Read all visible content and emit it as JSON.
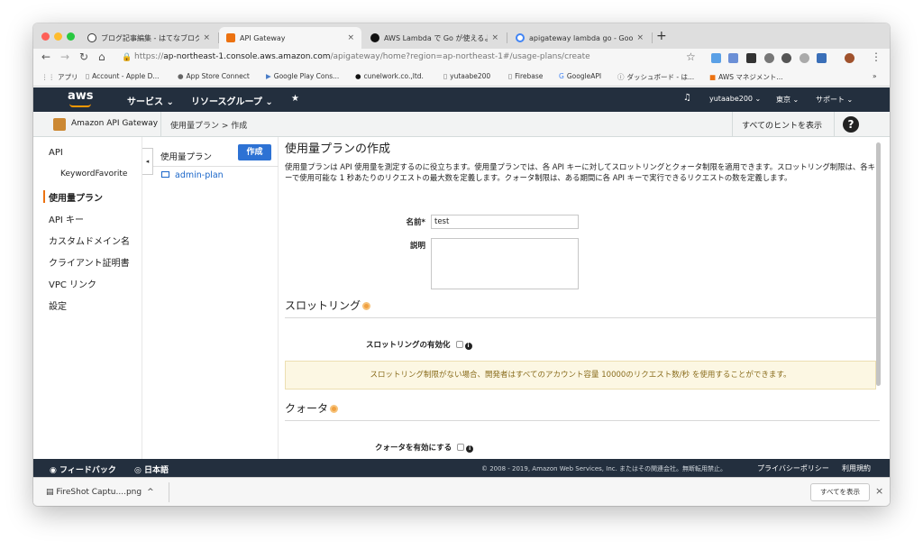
{
  "browser": {
    "tabs": [
      {
        "label": "ブログ記事編集 - はてなブログ",
        "close": "×",
        "icon_color": "#333333"
      },
      {
        "label": "API Gateway",
        "close": "×",
        "icon_color": "#ec7211"
      },
      {
        "label": "AWS Lambda で Go が使えるよ",
        "close": "×",
        "icon_color": "#111111"
      },
      {
        "label": "apigateway lambda go - Googl",
        "close": "×",
        "icon_color": "#4285f4"
      }
    ],
    "new_tab": "+",
    "url_prefix": "https://",
    "url_host": "ap-northeast-1.console.aws.amazon.com",
    "url_path": "/apigateway/home?region=ap-northeast-1#/usage-plans/create",
    "bookmarks": [
      {
        "icon": "apps-icon",
        "label": "アプリ"
      },
      {
        "icon": "page-icon",
        "label": "Account - Apple D..."
      },
      {
        "icon": "apple-icon",
        "label": "App Store Connect"
      },
      {
        "icon": "flag-icon",
        "label": "Google Play Cons..."
      },
      {
        "icon": "github-icon",
        "label": "cunelwork.co.,ltd."
      },
      {
        "icon": "page-icon",
        "label": "yutaabe200"
      },
      {
        "icon": "page-icon",
        "label": "Firebase"
      },
      {
        "icon": "google-icon",
        "label": "GoogleAPI"
      },
      {
        "icon": "info-icon",
        "label": "ダッシュボード - は..."
      },
      {
        "icon": "cube-icon",
        "label": "AWS マネジメント..."
      }
    ],
    "bookmarks_more": "»"
  },
  "aws": {
    "logo": "aws",
    "services": "サービス ⌄",
    "resource_groups": "リソースグループ ⌄",
    "pin": "★",
    "bell": "🔔",
    "user": "yutaabe200 ⌄",
    "region": "東京 ⌄",
    "support": "サポート ⌄"
  },
  "service_bar": {
    "name": "Amazon API Gateway",
    "breadcrumb": "使用量プラン  >  作成",
    "show_hints": "すべてのヒントを表示",
    "help": "?"
  },
  "left_nav": {
    "items": [
      {
        "label": "API",
        "sub": false,
        "active": false
      },
      {
        "label": "KeywordFavorite",
        "sub": true,
        "active": false
      },
      {
        "label": "使用量プラン",
        "sub": false,
        "active": true
      },
      {
        "label": "API キー",
        "sub": false,
        "active": false
      },
      {
        "label": "カスタムドメイン名",
        "sub": false,
        "active": false
      },
      {
        "label": "クライアント証明書",
        "sub": false,
        "active": false
      },
      {
        "label": "VPC リンク",
        "sub": false,
        "active": false
      },
      {
        "label": "設定",
        "sub": false,
        "active": false
      }
    ],
    "collapse": "◂"
  },
  "plan_list": {
    "header": "使用量プラン",
    "create_button": "作成",
    "items": [
      "admin-plan"
    ]
  },
  "main": {
    "title": "使用量プランの作成",
    "description": "使用量プランは API 使用量を測定するのに役立ちます。使用量プランでは、各 API キーに対してスロットリングとクォータ制限を適用できます。スロットリング制限は、各キーで使用可能な 1 秒あたりのリクエストの最大数を定義します。クォータ制限は、ある期間に各 API キーで実行できるリクエストの数を定義します。",
    "name_label": "名前*",
    "name_value": "test",
    "desc_label": "説明",
    "desc_value": "",
    "throttling_title": "スロットリング",
    "throttling_toggle": "スロットリングの有効化",
    "throttling_notice": "スロットリング制限がない場合、開発者はすべてのアカウント容量 10000のリクエスト数/秒 を使用することができます。",
    "quota_title": "クォータ",
    "quota_toggle": "クォータを有効にする",
    "info": "i"
  },
  "footer": {
    "feedback": "フィードバック",
    "language": "日本語",
    "copyright": "© 2008 - 2019, Amazon Web Services, Inc. またはその関連会社。無断転用禁止。",
    "privacy": "プライバシーポリシー",
    "terms": "利用規約"
  },
  "downloads": {
    "file": "FireShot Captu....png",
    "chevron": "^",
    "show_all": "すべてを表示",
    "close": "×"
  }
}
